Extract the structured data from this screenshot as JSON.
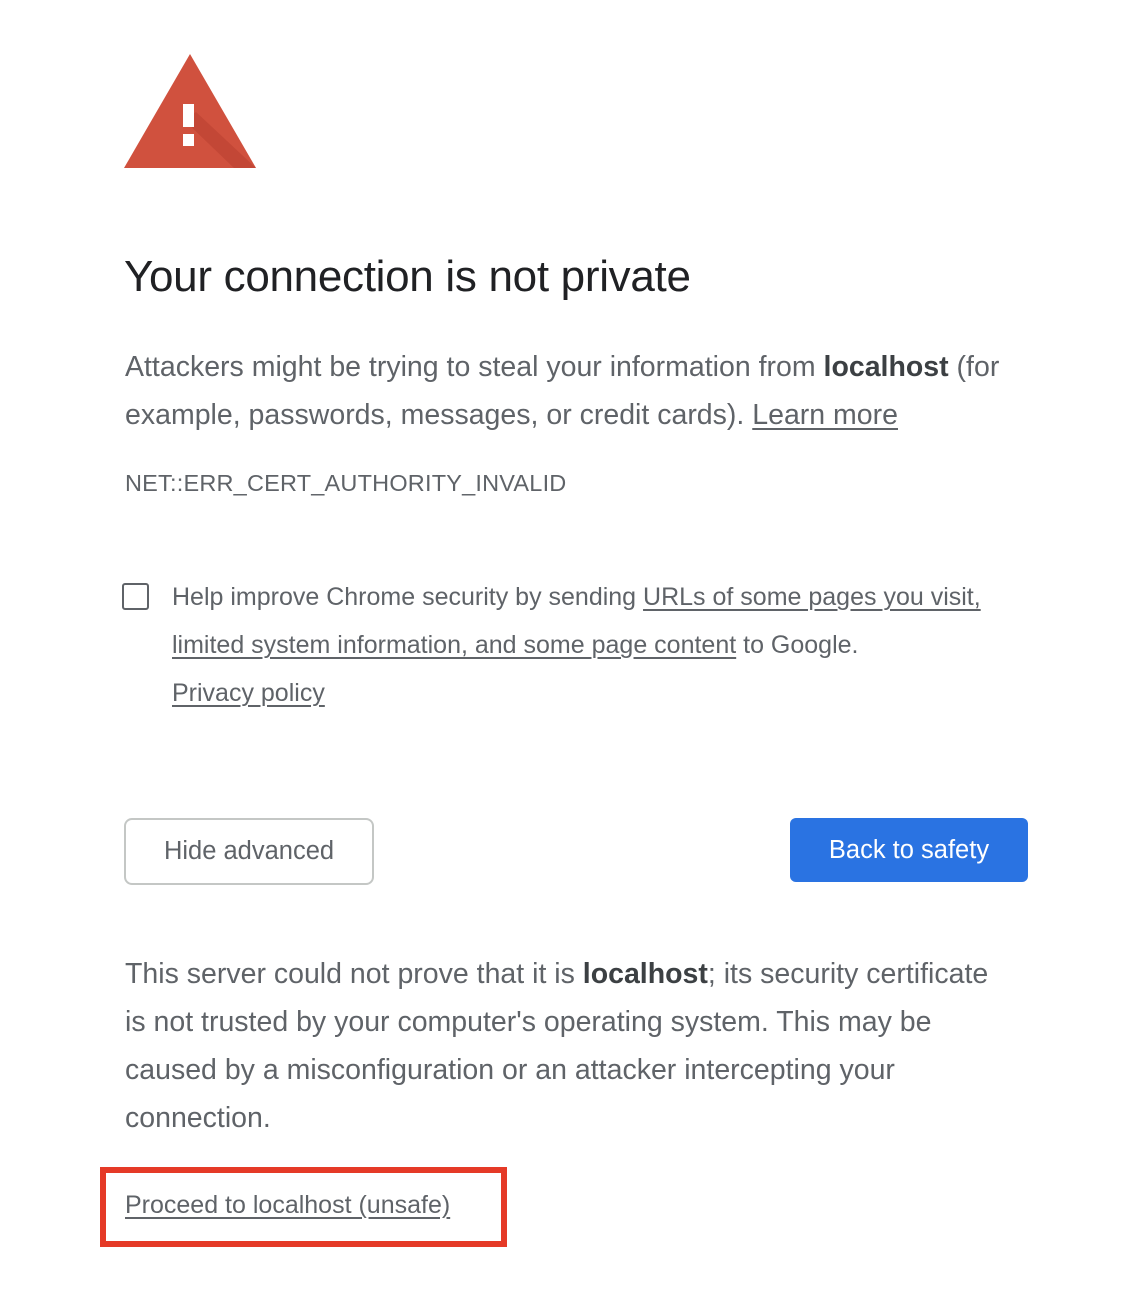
{
  "icons": {
    "warning": "warning-triangle-icon"
  },
  "colors": {
    "warning_red": "#d0513e",
    "primary_button": "#2a73e2",
    "highlight_box": "#e53a27",
    "title_text": "#202124",
    "body_text": "#5f6368"
  },
  "title": "Your connection is not private",
  "main_message": {
    "prefix": "Attackers might be trying to steal your information from ",
    "host": "localhost",
    "suffix": " (for example, passwords, messages, or credit cards). ",
    "learn_more": "Learn more"
  },
  "error_code": "NET::ERR_CERT_AUTHORITY_INVALID",
  "optin": {
    "checked": false,
    "prefix": "Help improve Chrome security by sending ",
    "link": "URLs of some pages you visit, limited system information, and some page content",
    "suffix": " to Google. ",
    "privacy_link": "Privacy policy"
  },
  "buttons": {
    "hide_advanced": "Hide advanced",
    "back_to_safety": "Back to safety"
  },
  "details": {
    "prefix": "This server could not prove that it is ",
    "host": "localhost",
    "suffix": "; its security certificate is not trusted by your computer's operating system. This may be caused by a misconfiguration or an attacker intercepting your connection."
  },
  "proceed_link": "Proceed to localhost (unsafe)"
}
